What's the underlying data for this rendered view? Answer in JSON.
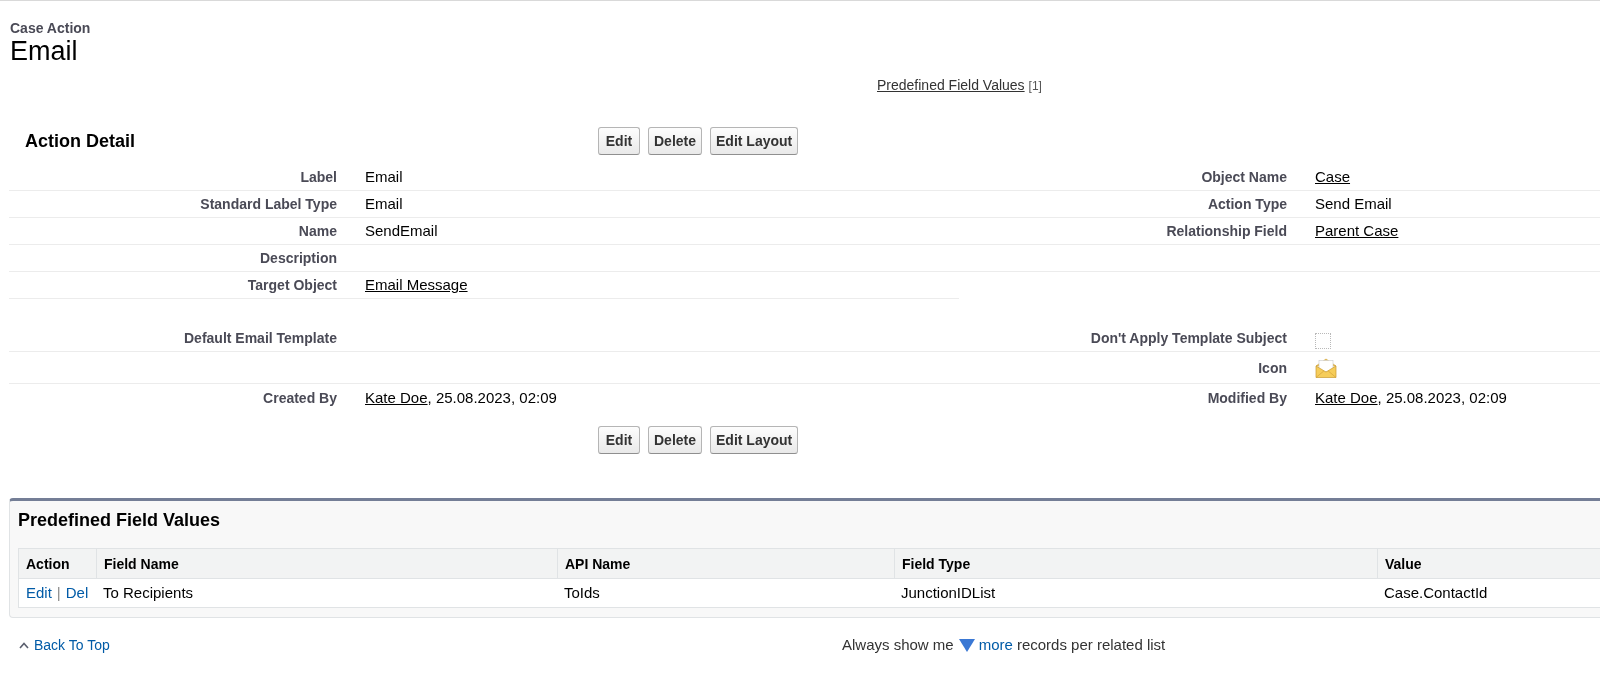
{
  "header": {
    "object_type": "Case Action",
    "title": "Email"
  },
  "related_list_links": [
    {
      "label": "Predefined Field Values",
      "count": "[1]"
    }
  ],
  "detail": {
    "title": "Action Detail",
    "top_buttons": [
      "Edit",
      "Delete",
      "Edit Layout"
    ],
    "sections": [
      {
        "rows": [
          {
            "left": {
              "label": "Label",
              "kind": "text",
              "value": "Email"
            },
            "right": {
              "label": "Object Name",
              "kind": "link",
              "value": "Case"
            }
          },
          {
            "left": {
              "label": "Standard Label Type",
              "kind": "text",
              "value": "Email"
            },
            "right": {
              "label": "Action Type",
              "kind": "text",
              "value": "Send Email"
            }
          },
          {
            "left": {
              "label": "Name",
              "kind": "text",
              "value": "SendEmail"
            },
            "right": {
              "label": "Relationship Field",
              "kind": "link",
              "value": "Parent Case"
            }
          },
          {
            "left": {
              "label": "Description",
              "kind": "text"
            }
          },
          {
            "left": {
              "label": "Target Object",
              "kind": "link",
              "value": "Email Message"
            }
          }
        ]
      },
      {
        "rows": [
          {
            "left": {
              "label": "Default Email Template",
              "kind": "text"
            },
            "right": {
              "label": "Don't Apply Template Subject",
              "kind": "checkbox",
              "checked": false
            }
          },
          {
            "right": {
              "label": "Icon",
              "kind": "icon"
            }
          },
          {
            "left": {
              "label": "Created By",
              "kind": "stamp",
              "user": "Kate Doe",
              "date": ", 25.08.2023, 02:09"
            },
            "right": {
              "label": "Modified By",
              "kind": "stamp",
              "user": "Kate Doe",
              "date": ", 25.08.2023, 02:09"
            }
          }
        ]
      }
    ],
    "bottom_buttons": [
      "Edit",
      "Delete",
      "Edit Layout"
    ]
  },
  "related_list": {
    "title": "Predefined Field Values",
    "columns": [
      "Action",
      "Field Name",
      "API Name",
      "Field Type",
      "Value"
    ],
    "rows": [
      {
        "cells": [
          {
            "kind": "actions",
            "links": [
              "Edit",
              "Del"
            ],
            "separator": "|"
          },
          {
            "kind": "text",
            "text": "To Recipients"
          },
          {
            "kind": "text",
            "text": "ToIds"
          },
          {
            "kind": "text",
            "text": "JunctionIDList"
          },
          {
            "kind": "text",
            "text": "Case.ContactId"
          }
        ]
      }
    ]
  },
  "footer": {
    "back_to_top": "Back To Top",
    "show_more": {
      "before": "Always show me",
      "link": "more",
      "after": "records per related list"
    }
  }
}
